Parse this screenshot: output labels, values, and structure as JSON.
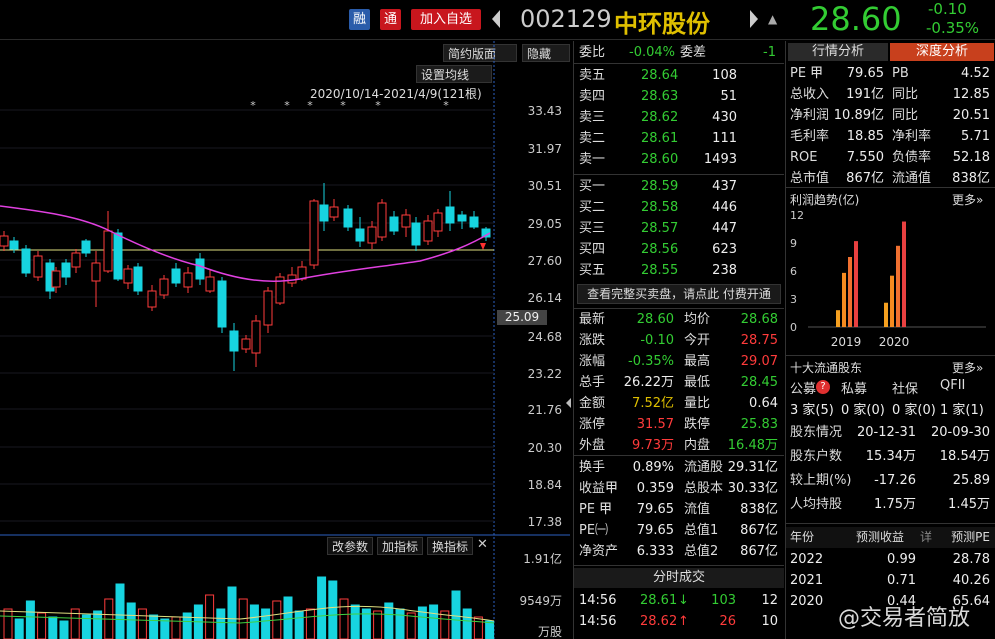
{
  "top": {
    "rong": "融",
    "tong": "通",
    "add": "加入自选",
    "code": "002129",
    "name": "中环股份",
    "price": "28.60",
    "change": "-0.10",
    "pct": "-0.35%"
  },
  "chart": {
    "layout_btn": "简约版面",
    "hide_btn": "隐藏",
    "ma_btn": "设置均线",
    "range": "2020/10/14-2021/4/9(121根)",
    "yticks": [
      "33.43",
      "31.97",
      "30.51",
      "29.05",
      "27.60",
      "26.14",
      "24.68",
      "23.22",
      "21.76",
      "20.30",
      "18.84",
      "17.38"
    ],
    "price_tag": "25.09",
    "vol_btns": [
      "改参数",
      "加指标",
      "换指标"
    ],
    "vol_ticks": [
      "1.91亿",
      "9549万",
      "万股"
    ]
  },
  "order": {
    "wb_label": "委比",
    "wb": "-0.04%",
    "wc_label": "委差",
    "wc": "-1",
    "sells": [
      {
        "l": "卖五",
        "p": "28.64",
        "v": "108"
      },
      {
        "l": "卖四",
        "p": "28.63",
        "v": "51"
      },
      {
        "l": "卖三",
        "p": "28.62",
        "v": "430"
      },
      {
        "l": "卖二",
        "p": "28.61",
        "v": "111"
      },
      {
        "l": "卖一",
        "p": "28.60",
        "v": "1493"
      }
    ],
    "buys": [
      {
        "l": "买一",
        "p": "28.59",
        "v": "437"
      },
      {
        "l": "买二",
        "p": "28.58",
        "v": "446"
      },
      {
        "l": "买三",
        "p": "28.57",
        "v": "447"
      },
      {
        "l": "买四",
        "p": "28.56",
        "v": "623"
      },
      {
        "l": "买五",
        "p": "28.55",
        "v": "238"
      }
    ],
    "full_link": "查看完整买卖盘，请点此 付费开通"
  },
  "stats": [
    [
      "最新",
      "28.60",
      "g",
      "均价",
      "28.68",
      "g"
    ],
    [
      "涨跌",
      "-0.10",
      "g",
      "今开",
      "28.75",
      "r"
    ],
    [
      "涨幅",
      "-0.35%",
      "g",
      "最高",
      "29.07",
      "r"
    ],
    [
      "总手",
      "26.22万",
      "w",
      "最低",
      "28.45",
      "g"
    ],
    [
      "金额",
      "7.52亿",
      "y",
      "量比",
      "0.64",
      "w"
    ],
    [
      "涨停",
      "31.57",
      "r",
      "跌停",
      "25.83",
      "g"
    ],
    [
      "外盘",
      "9.73万",
      "r",
      "内盘",
      "16.48万",
      "g"
    ]
  ],
  "stats2": [
    [
      "换手",
      "0.89%",
      "流通股",
      "29.31亿"
    ],
    [
      "收益㆙",
      "0.359",
      "总股本",
      "30.33亿"
    ],
    [
      "PE ㆙",
      "79.65",
      "流值",
      "838亿"
    ],
    [
      "PE㈠",
      "79.65",
      "总值1",
      "867亿"
    ],
    [
      "净资产",
      "6.333",
      "总值2",
      "867亿"
    ]
  ],
  "ticks": {
    "title": "分时成交",
    "rows": [
      [
        "14:56",
        "28.61",
        "↓",
        "103",
        "12"
      ],
      [
        "14:56",
        "28.62",
        "↑",
        "26",
        "10"
      ]
    ]
  },
  "right": {
    "tab1": "行情分析",
    "tab2": "深度分析",
    "fin": [
      [
        "PE ㆙",
        "79.65",
        "PB",
        "4.52"
      ],
      [
        "总收入",
        "191亿",
        "同比",
        "12.85"
      ],
      [
        "净利润",
        "10.89亿",
        "同比",
        "20.51"
      ],
      [
        "毛利率",
        "18.85",
        "净利率",
        "5.71"
      ],
      [
        "ROE",
        "7.550",
        "负债率",
        "52.18"
      ],
      [
        "总市值",
        "867亿",
        "流通值",
        "838亿"
      ]
    ],
    "profit_title": "利润趋势(亿)",
    "more": "更多»",
    "profit_years": [
      "2019",
      "2020"
    ],
    "profit_values": {
      "2019": [
        1.8,
        5.8,
        7.5,
        9.2
      ],
      "2020": [
        2.6,
        5.5,
        8.7,
        11.3
      ]
    },
    "profit_ticks": [
      "12",
      "9",
      "6",
      "3",
      "0"
    ],
    "holders_title": "十大流通股东",
    "holders_more": "更多»",
    "holder_types": [
      "公募",
      "私募",
      "社保",
      "QFII"
    ],
    "holder_counts": [
      "3 家(5)",
      "0 家(0)",
      "0 家(0)",
      "1 家(1)"
    ],
    "holder_rows": [
      [
        "股东情况",
        "20-12-31",
        "20-09-30"
      ],
      [
        "股东户数",
        "15.34万",
        "18.54万"
      ],
      [
        "较上期(%)",
        "-17.26",
        "25.89"
      ],
      [
        "人均持股",
        "1.75万",
        "1.45万"
      ]
    ],
    "fc_head": [
      "年份",
      "预测收益",
      "详",
      "预测PE"
    ],
    "fc_rows": [
      [
        "2022",
        "0.99",
        "28.78"
      ],
      [
        "2021",
        "0.71",
        "40.26"
      ],
      [
        "2020",
        "0.44",
        "65.64"
      ]
    ]
  },
  "watermark": "@交易者简放"
}
